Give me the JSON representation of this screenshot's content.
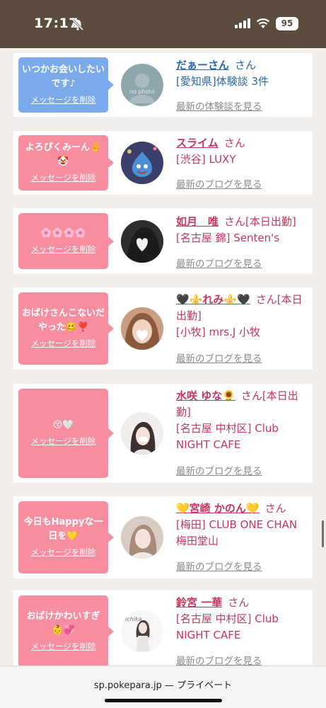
{
  "status": {
    "time": "17:17",
    "battery": "95"
  },
  "cards": [
    {
      "bubble": "いつかお会いしたいです♪",
      "delete": "メッセージを削除",
      "name": "だぁーさん",
      "san": "さん",
      "sub1": "[愛知県]体験談 3件",
      "sub2": "",
      "link": "最新の体験談を見る",
      "avatar_text": "no photo"
    },
    {
      "bubble": "よろぴくみーん✌️🤡",
      "delete": "メッセージを削除",
      "name": "スライム",
      "san": "さん",
      "sub1": "[渋谷] LUXY",
      "sub2": "",
      "link": "最新のブログを見る"
    },
    {
      "bubble": "🌸🌸🌸🌸",
      "delete": "メッセージを削除",
      "name": "如月　唯",
      "san": "さん[本日出勤]",
      "sub1": "[名古屋 錦] Senten's",
      "sub2": "",
      "link": "最新のブログを見る"
    },
    {
      "bubble": "おばけさんこないだやった🥴❣️",
      "delete": "メッセージを削除",
      "name": "🖤⚜️れみ⚜️🖤",
      "san": "さん[本日出勤]",
      "sub1": "[小牧] mrs.J 小牧",
      "sub2": "",
      "link": "最新のブログを見る"
    },
    {
      "bubble": "😚🤍",
      "delete": "メッセージを削除",
      "name": "水咲 ゆな🌻",
      "san": "さん[本日出勤]",
      "sub1": "[名古屋 中村区] Club NIGHT CAFE",
      "sub2": "",
      "link": "最新のブログを見る"
    },
    {
      "bubble": "今日もHappyな一日を💛",
      "delete": "メッセージを削除",
      "name": "💛宮崎 かのん💛",
      "san": "さん",
      "sub1": "[梅田] CLUB ONE CHAN 梅田堂山",
      "sub2": "",
      "link": "最新のブログを見る"
    },
    {
      "bubble": "おばけかわいすぎ👶💞",
      "delete": "メッセージを削除",
      "name": "鈴宮 一華",
      "san": "さん",
      "sub1": "[名古屋 中村区] Club NIGHT CAFE",
      "sub2": "",
      "link": "最新のブログを見る",
      "avatar_text": "Ichika"
    }
  ],
  "browser": {
    "url": "sp.pokepara.jp — プライベート"
  }
}
